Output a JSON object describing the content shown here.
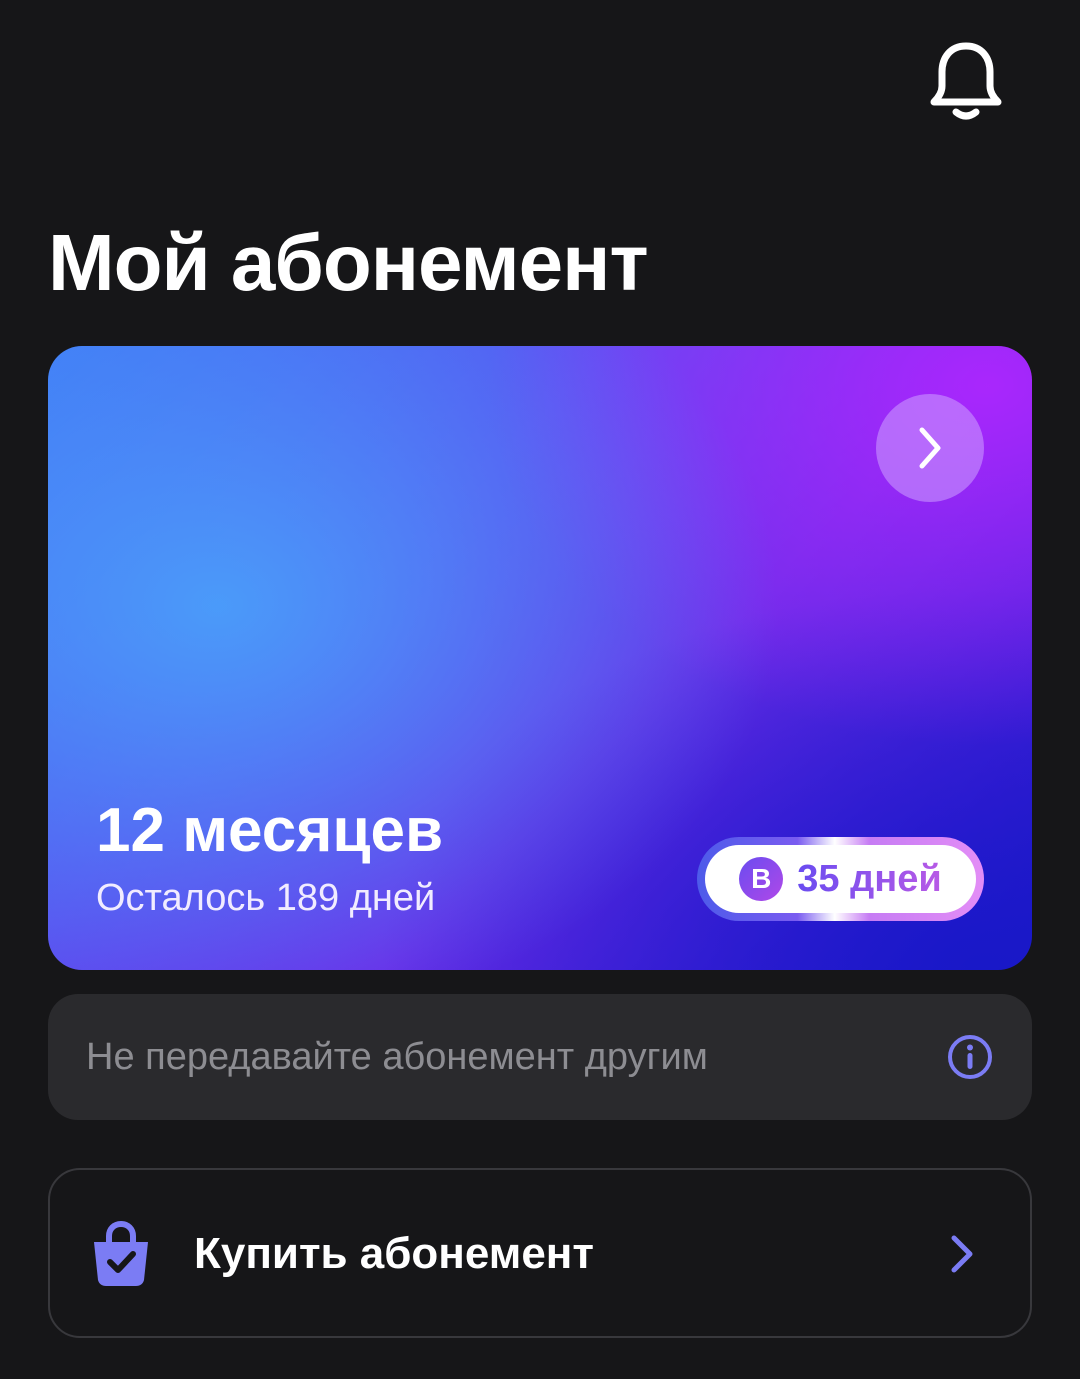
{
  "header": {
    "bell_icon": "bell-icon",
    "title": "Мой абонемент"
  },
  "subscription_card": {
    "plan_name": "12 месяцев",
    "remaining": "Осталось 189 дней",
    "arrow_icon": "chevron-right-icon",
    "bonus": {
      "coin_letter": "B",
      "label": "35 дней"
    },
    "colors": {
      "gradient_blue": "#4A9EFA",
      "gradient_purple": "#B026FF",
      "gradient_deep_blue": "#1818C8"
    }
  },
  "notice": {
    "text": "Не передавайте абонемент другим",
    "icon": "info-icon"
  },
  "buy": {
    "label": "Купить абонемент",
    "icon": "shopping-bag-check-icon",
    "chevron": "chevron-right-icon",
    "accent": "#7B7CF4"
  }
}
